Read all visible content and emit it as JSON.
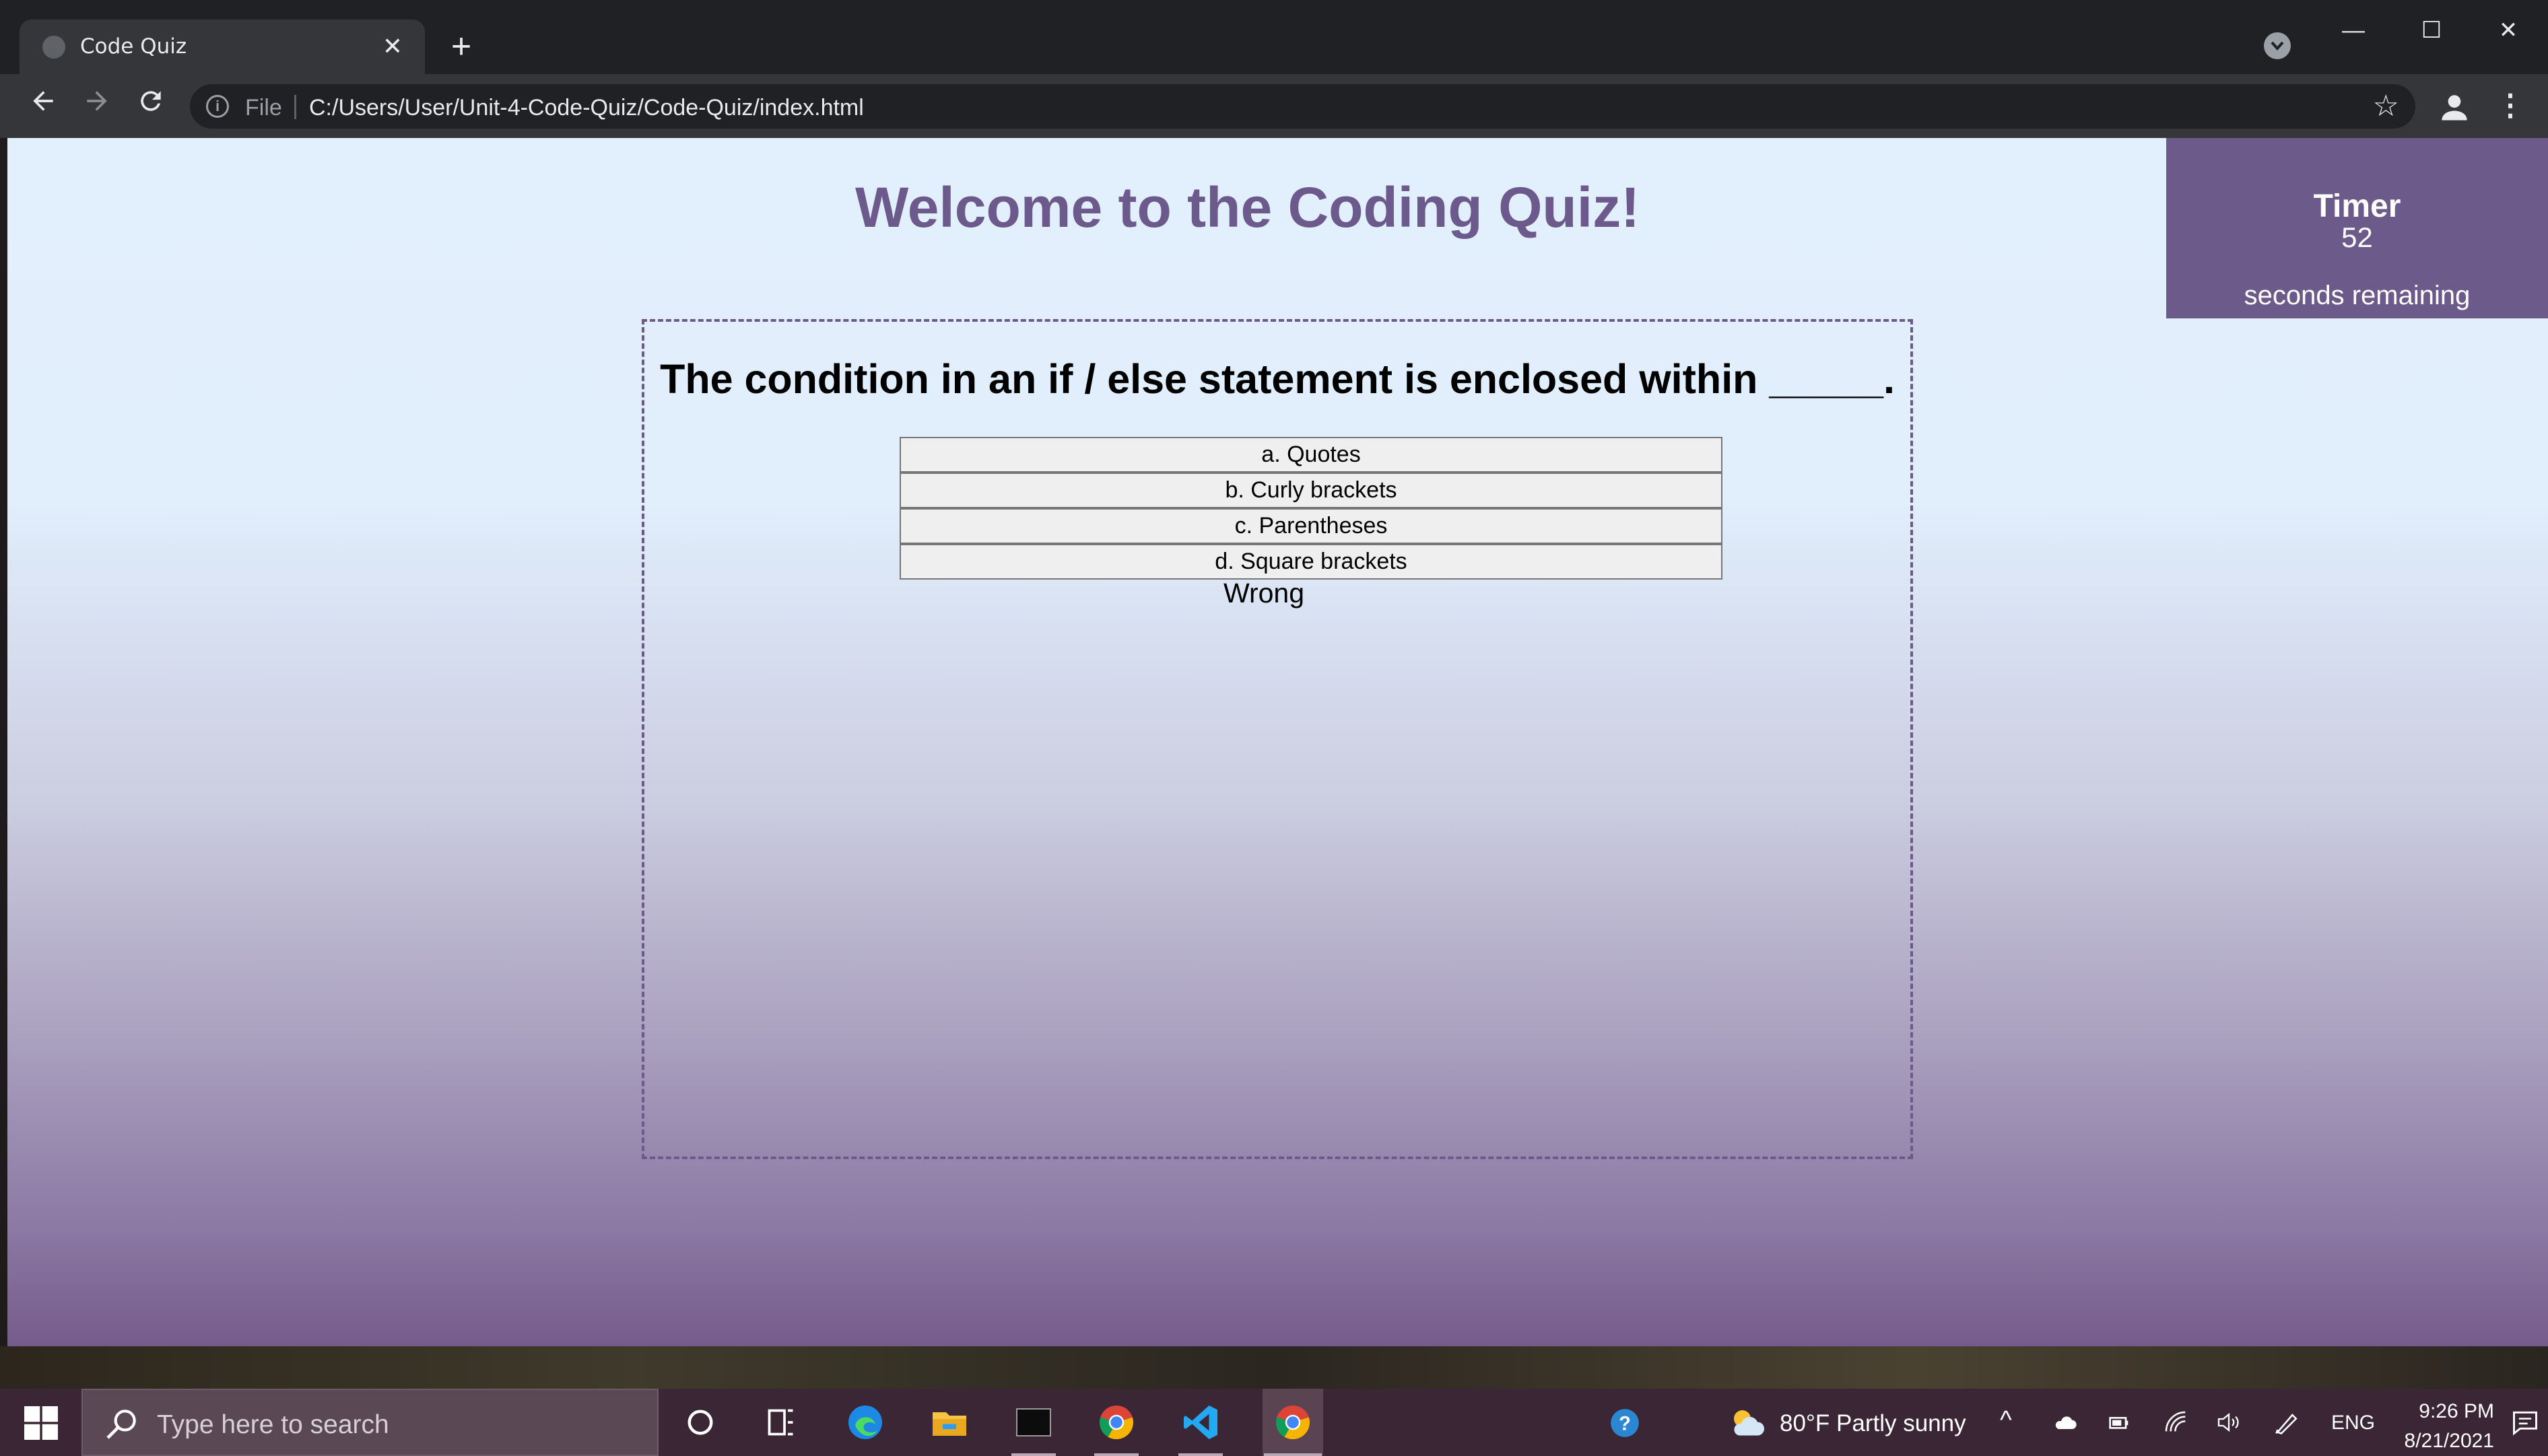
{
  "browser": {
    "tab_title": "Code Quiz",
    "tab_close": "✕",
    "new_tab": "+",
    "scheme_label": "File",
    "url": "C:/Users/User/Unit-4-Code-Quiz/Code-Quiz/index.html",
    "window_controls": {
      "minimize": "—",
      "maximize": "☐",
      "close": "✕"
    }
  },
  "page": {
    "heading": "Welcome to the Coding Quiz!",
    "timer": {
      "label": "Timer",
      "value": "52",
      "suffix": "seconds remaining"
    },
    "question": "The condition in an if / else statement is enclosed within _____.",
    "answers": [
      "a. Quotes",
      "b. Curly brackets",
      "c. Parentheses",
      "d. Square brackets"
    ],
    "feedback": "Wrong",
    "colors": {
      "accent": "#6c5a8b",
      "background_top": "#e2effd",
      "background_bottom": "#755b8b"
    }
  },
  "taskbar": {
    "search_placeholder": "Type here to search",
    "weather": "80°F  Partly sunny",
    "language": "ENG",
    "time": "9:26 PM",
    "date": "8/21/2021",
    "pinned_icons": [
      "cortana-icon",
      "task-view-icon",
      "edge-icon",
      "file-explorer-icon",
      "terminal-icon",
      "chrome-icon",
      "vscode-icon",
      "chrome-active-icon"
    ]
  }
}
